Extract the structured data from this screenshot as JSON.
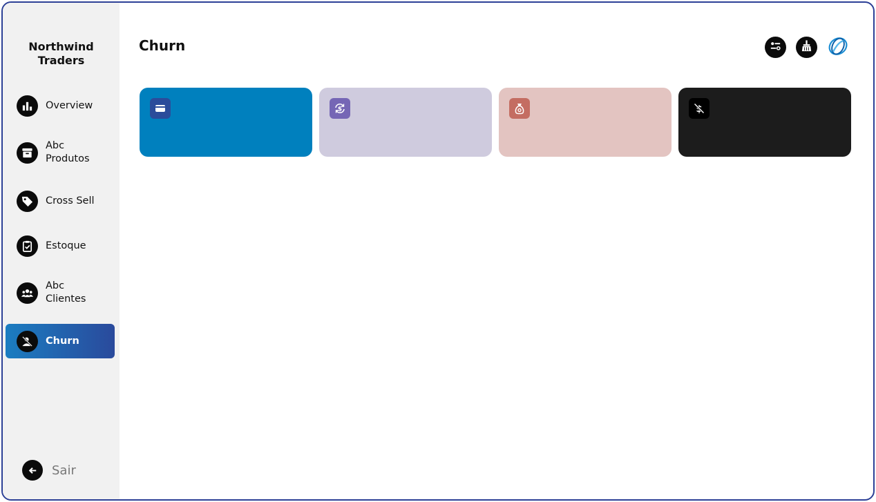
{
  "app": {
    "brand_line1": "Northwind",
    "brand_line2": "Traders"
  },
  "sidebar": {
    "items": [
      {
        "label_line1": "Overview",
        "label_line2": "",
        "icon": "bar-chart-icon",
        "active": false
      },
      {
        "label_line1": "Abc",
        "label_line2": "Produtos",
        "icon": "archive-box-icon",
        "active": false
      },
      {
        "label_line1": "Cross Sell",
        "label_line2": "",
        "icon": "price-tag-icon",
        "active": false
      },
      {
        "label_line1": "Estoque",
        "label_line2": "",
        "icon": "clipboard-check-icon",
        "active": false
      },
      {
        "label_line1": "Abc",
        "label_line2": "Clientes",
        "icon": "users-group-icon",
        "active": false
      },
      {
        "label_line1": "Churn",
        "label_line2": "",
        "icon": "user-off-icon",
        "active": true
      }
    ],
    "logout_label": "Sair"
  },
  "header": {
    "title": "Churn",
    "actions": [
      "filter-settings-icon",
      "clear-broom-icon",
      "company-logo-icon"
    ]
  },
  "cards": [
    {
      "icon": "wallet-icon",
      "bg": "#0080be",
      "icon_bg": "#2b4c9b"
    },
    {
      "icon": "currency-exchange-icon",
      "bg": "#cfcbde",
      "icon_bg": "#7566b5"
    },
    {
      "icon": "money-bag-icon",
      "bg": "#e3c4c1",
      "icon_bg": "#c46d62"
    },
    {
      "icon": "money-off-icon",
      "bg": "#1c1c1c",
      "icon_bg": "#000000"
    }
  ],
  "colors": {
    "accent_start": "#1b7dc1",
    "accent_end": "#2a4a9c",
    "frame_border": "#2b3f96",
    "sidebar_bg": "#f1f1f1"
  }
}
